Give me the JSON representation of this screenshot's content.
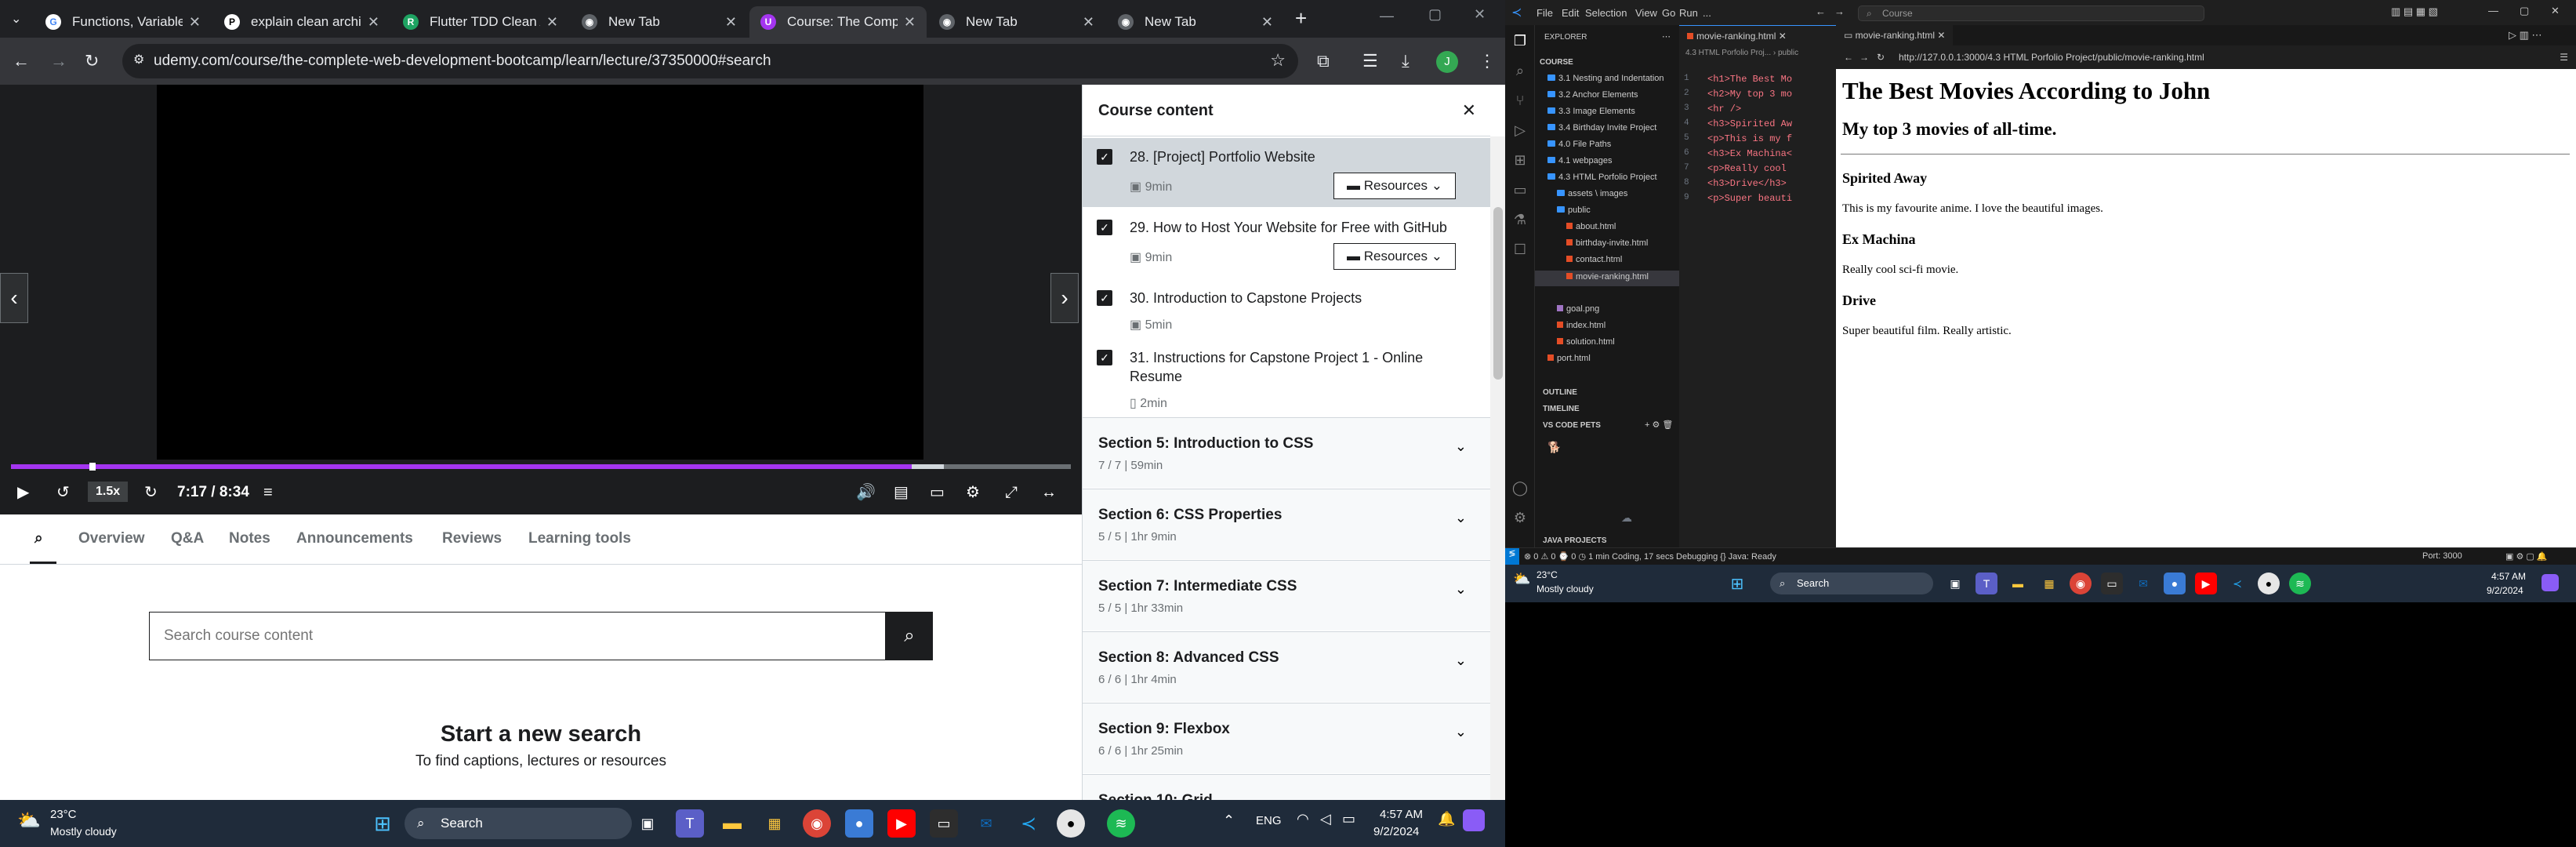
{
  "browser": {
    "tabs": [
      {
        "title": "Functions, Variables",
        "favicon": "google-icon"
      },
      {
        "title": "explain clean archite",
        "favicon": "perplexity-icon"
      },
      {
        "title": "Flutter TDD Clean Ar",
        "favicon": "resocoder-icon"
      },
      {
        "title": "New Tab",
        "favicon": "chrome-icon"
      },
      {
        "title": "Course: The Comple",
        "favicon": "udemy-icon"
      },
      {
        "title": "New Tab",
        "favicon": "chrome-icon"
      },
      {
        "title": "New Tab",
        "favicon": "chrome-icon"
      }
    ],
    "new_tab": "+",
    "url": "udemy.com/course/the-complete-web-development-bootcamp/learn/lecture/37350000#search",
    "profile_initial": "J"
  },
  "player": {
    "speed": "1.5x",
    "time": "7:17 / 8:34",
    "progress": 0.85,
    "buffered": 0.88
  },
  "page_tabs": [
    "Overview",
    "Q&A",
    "Notes",
    "Announcements",
    "Reviews",
    "Learning tools"
  ],
  "search": {
    "placeholder": "Search course content",
    "heading": "Start a new search",
    "subheading": "To find captions, lectures or resources"
  },
  "course": {
    "title": "Course content",
    "lectures": [
      {
        "title": "28. [Project] Portfolio Website",
        "duration": "9min",
        "resources": "Resources"
      },
      {
        "title": "29. How to Host Your Website for Free with GitHub",
        "duration": "9min",
        "resources": "Resources"
      },
      {
        "title": "30. Introduction to Capstone Projects",
        "duration": "5min"
      },
      {
        "title": "31. Instructions for Capstone Project 1 - Online Resume",
        "duration": "2min"
      }
    ],
    "sections": [
      {
        "title": "Section 5: Introduction to CSS",
        "sub": "7 / 7 | 59min"
      },
      {
        "title": "Section 6: CSS Properties",
        "sub": "5 / 5 | 1hr 9min"
      },
      {
        "title": "Section 7: Intermediate CSS",
        "sub": "5 / 5 | 1hr 33min"
      },
      {
        "title": "Section 8: Advanced CSS",
        "sub": "6 / 6 | 1hr 4min"
      },
      {
        "title": "Section 9: Flexbox",
        "sub": "6 / 6 | 1hr 25min"
      },
      {
        "title": "Section 10: Grid",
        "sub": ""
      }
    ]
  },
  "taskbar_left": {
    "weather_temp": "23°C",
    "weather_desc": "Mostly cloudy",
    "search": "Search",
    "lang": "ENG",
    "time": "4:57 AM",
    "date": "9/2/2024"
  },
  "vscode": {
    "menu": [
      "File",
      "Edit",
      "Selection",
      "View",
      "Go",
      "Run",
      "..."
    ],
    "search": "Course",
    "explorer_label": "EXPLORER",
    "root": "COURSE",
    "tree": [
      "3.1 Nesting and Indentation",
      "3.2 Anchor Elements",
      "3.3 Image Elements",
      "3.4 Birthday Invite Project",
      "4.0 File Paths",
      "4.1 webpages",
      "4.3 HTML Porfolio Project",
      "assets \\ images",
      "public",
      "about.html",
      "birthday-invite.html",
      "contact.html",
      "movie-ranking.html",
      "goal.png",
      "index.html",
      "solution.html",
      "port.html"
    ],
    "outline": "OUTLINE",
    "timeline": "TIMELINE",
    "pets": "VS CODE PETS",
    "java": "JAVA PROJECTS",
    "editor_tab": "movie-ranking.html",
    "breadcrumb": "4.3 HTML Porfolio Proj... › public",
    "code": [
      "<h1>The Best Mo",
      "<h2>My top 3 mo",
      "<hr />",
      "<h3>Spirited Aw",
      "<p>This is my f",
      "<h3>Ex Machina<",
      "<p>Really cool ",
      "<h3>Drive</h3>",
      "<p>Super beauti"
    ],
    "preview_tab": "movie-ranking.html",
    "preview_url": "http://127.0.0.1:3000/4.3 HTML Porfolio Project/public/movie-ranking.html",
    "status": {
      "left": "⊗ 0 ⚠ 0   ⌚ 0   ◷ 1 min Coding, 17 secs Debugging   {} Java: Ready",
      "right": "Port: 3000"
    }
  },
  "movie_page": {
    "h1": "The Best Movies According to John",
    "h2": "My top 3 movies of all-time.",
    "movies": [
      {
        "name": "Spirited Away",
        "desc": "This is my favourite anime. I love the beautiful images."
      },
      {
        "name": "Ex Machina",
        "desc": "Really cool sci-fi movie."
      },
      {
        "name": "Drive",
        "desc": "Super beautiful film. Really artistic."
      }
    ]
  },
  "taskbar_right": {
    "weather_temp": "23°C",
    "weather_desc": "Mostly cloudy",
    "search": "Search",
    "time": "4:57 AM",
    "date": "9/2/2024"
  },
  "colors": {
    "udemy_purple": "#a435f0",
    "vscode_blue": "#3794ff"
  }
}
